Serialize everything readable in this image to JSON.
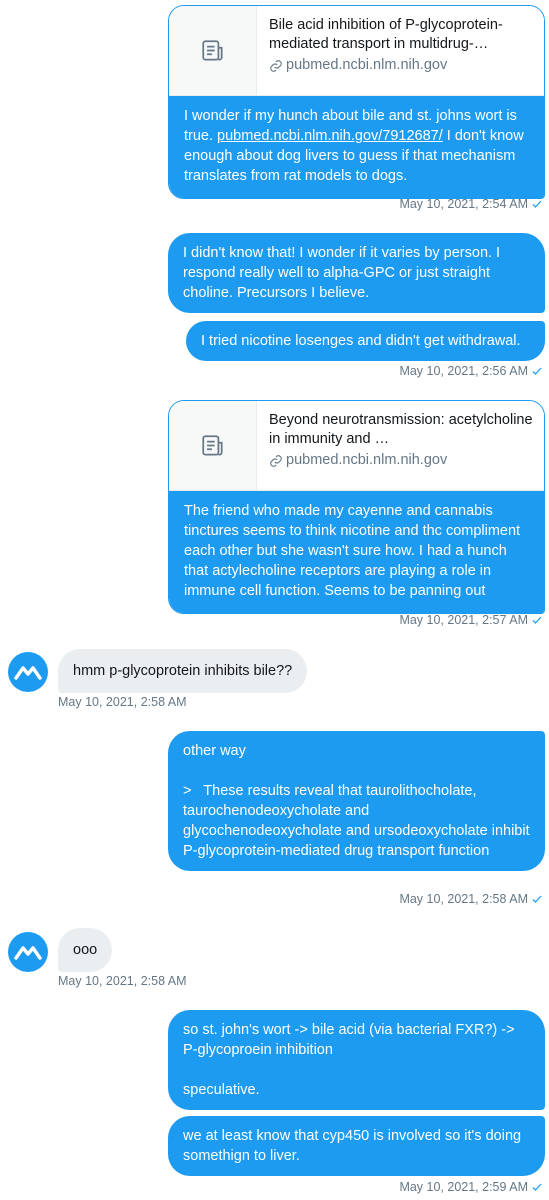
{
  "conversation": {
    "card1": {
      "title": "Bile acid inhibition of P-glycoprotein-mediated transport in multidrug-…",
      "domain": "pubmed.ncbi.nlm.nih.gov",
      "text_before_link": "I wonder if my hunch about bile and st. johns wort is true. ",
      "link": "pubmed.ncbi.nlm.nih.gov/7912687/",
      "text_after_link": " I don't know enough about dog livers to guess if that mechanism translates from rat models to dogs.",
      "timestamp": "May 10, 2021, 2:54 AM"
    },
    "msg2": {
      "text": "I didn't know that! I wonder if it varies by person. I respond really well to alpha-GPC or just straight choline. Precursors I believe."
    },
    "msg3": {
      "text": "I tried nicotine losenges and didn't get withdrawal.",
      "timestamp": "May 10, 2021, 2:56 AM"
    },
    "card2": {
      "title": "Beyond neurotransmission: acetylcholine in immunity and …",
      "domain": "pubmed.ncbi.nlm.nih.gov",
      "text": "The friend who made my cayenne and cannabis tinctures seems to think nicotine and thc compliment each other but she wasn't sure how. I had a hunch that actylecholine receptors are playing a role in immune cell function. Seems to be panning out",
      "timestamp": "May 10, 2021, 2:57 AM"
    },
    "in1": {
      "text": "hmm p-glycoprotein inhibits bile??",
      "timestamp": "May 10, 2021, 2:58 AM"
    },
    "msg4": {
      "text": "other way\n\n>   These results reveal that taurolithocholate, taurochenodeoxycholate and glycochenodeoxycholate and ursodeoxycholate inhibit P-glycoprotein-mediated drug transport function",
      "timestamp": "May 10, 2021, 2:58 AM"
    },
    "in2": {
      "text": "ooo",
      "timestamp": "May 10, 2021, 2:58 AM"
    },
    "msg5": {
      "text": "so st. john's wort -> bile acid (via bacterial FXR?) -> P-glycoproein inhibition\n\nspeculative."
    },
    "msg6": {
      "text": "we at least know that cyp450 is involved so it's doing somethign to liver.",
      "timestamp": "May 10, 2021, 2:59 AM"
    }
  },
  "icons": {
    "article": "article-icon",
    "link": "link-icon",
    "sent": "checkmark-icon",
    "avatar": "mountain-logo-icon"
  },
  "colors": {
    "accent": "#1d9bf0",
    "incoming_bubble": "#ebeef0",
    "meta_text": "#657786"
  }
}
